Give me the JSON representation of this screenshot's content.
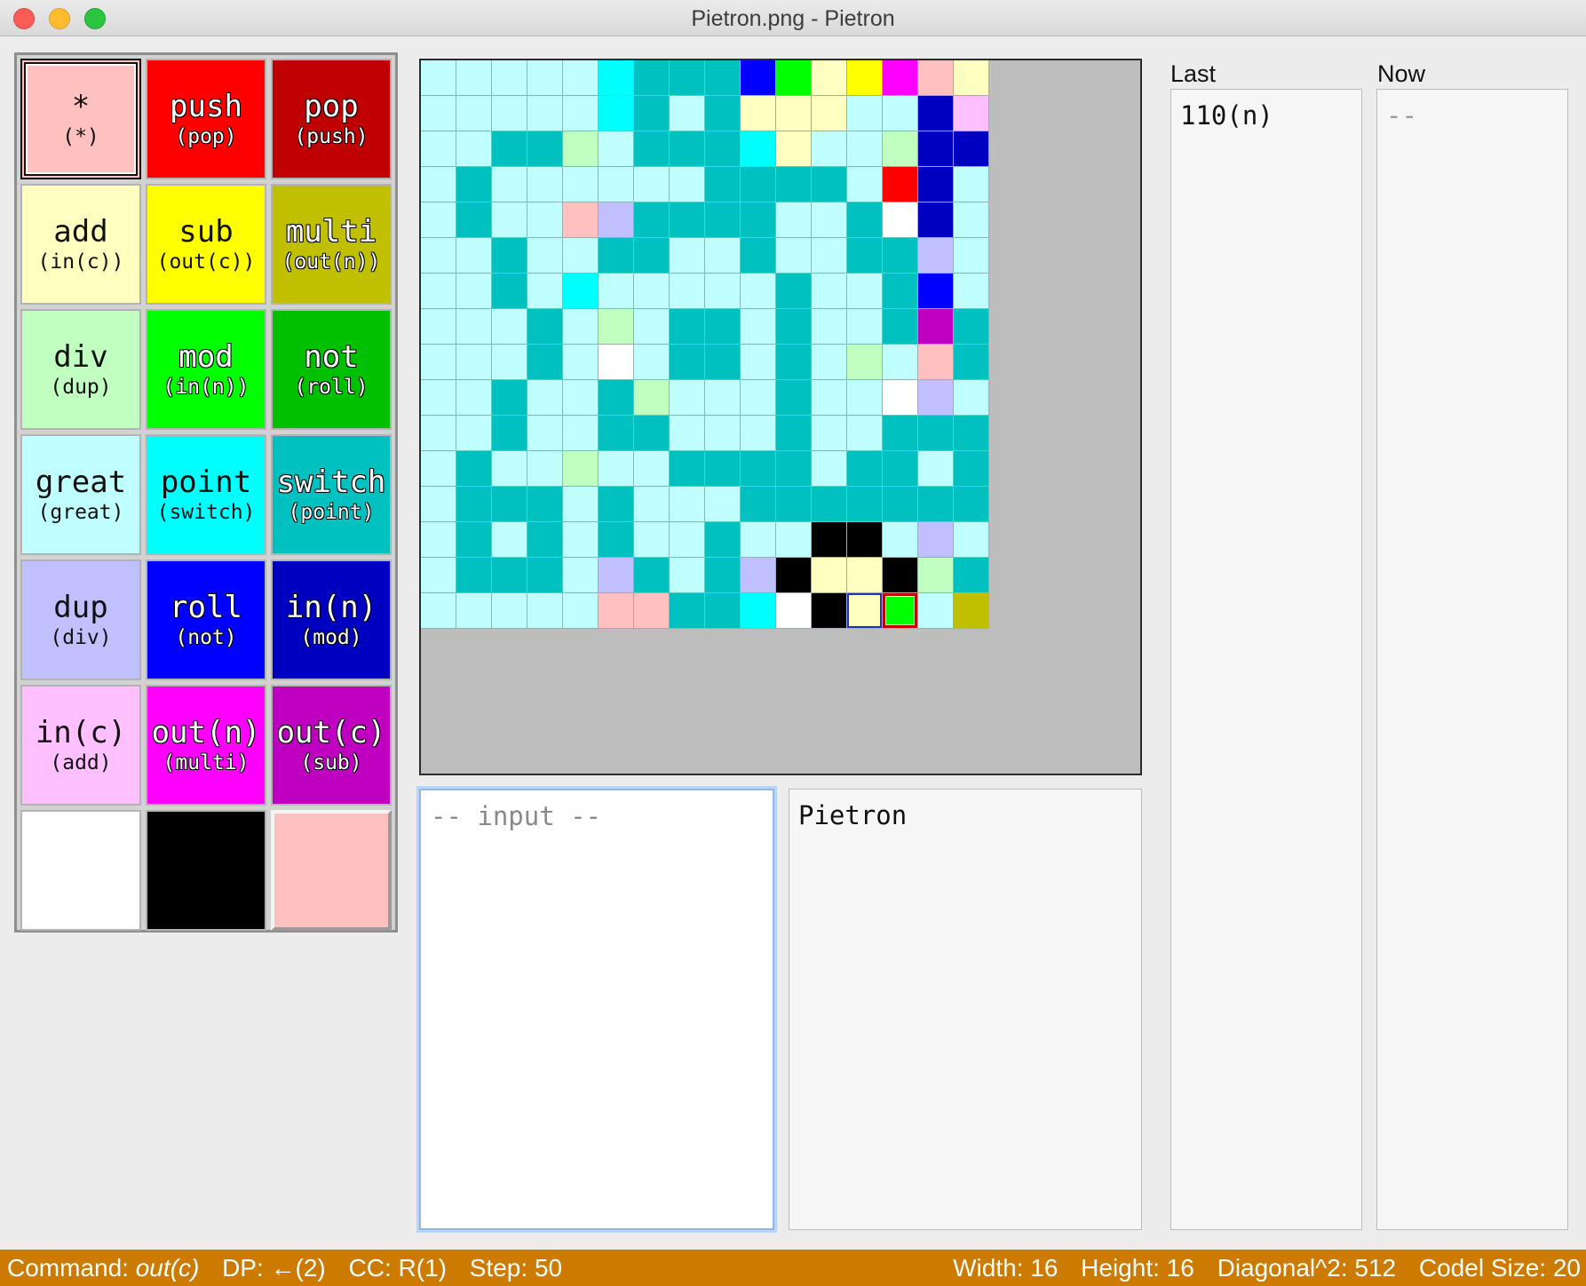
{
  "window": {
    "title": "Pietron.png - Pietron"
  },
  "palette": [
    {
      "op": "*",
      "sub": "(*)",
      "color": "#ffc0c0",
      "text": "light",
      "selected": true
    },
    {
      "op": "push",
      "sub": "(pop)",
      "color": "#ff0000",
      "text": "dark"
    },
    {
      "op": "pop",
      "sub": "(push)",
      "color": "#c00000",
      "text": "dark"
    },
    {
      "op": "add",
      "sub": "(in(c))",
      "color": "#ffffc0",
      "text": "light"
    },
    {
      "op": "sub",
      "sub": "(out(c))",
      "color": "#ffff00",
      "text": "light"
    },
    {
      "op": "multi",
      "sub": "(out(n))",
      "color": "#c0c000",
      "text": "dark"
    },
    {
      "op": "div",
      "sub": "(dup)",
      "color": "#c0ffc0",
      "text": "light"
    },
    {
      "op": "mod",
      "sub": "(in(n))",
      "color": "#00ff00",
      "text": "dark"
    },
    {
      "op": "not",
      "sub": "(roll)",
      "color": "#00c000",
      "text": "dark"
    },
    {
      "op": "great",
      "sub": "(great)",
      "color": "#c0ffff",
      "text": "light"
    },
    {
      "op": "point",
      "sub": "(switch)",
      "color": "#00ffff",
      "text": "light"
    },
    {
      "op": "switch",
      "sub": "(point)",
      "color": "#00c0c0",
      "text": "dark"
    },
    {
      "op": "dup",
      "sub": "(div)",
      "color": "#c0c0ff",
      "text": "light"
    },
    {
      "op": "roll",
      "sub": "(not)",
      "color": "#0000ff",
      "text": "dark"
    },
    {
      "op": "in(n)",
      "sub": "(mod)",
      "color": "#0000c0",
      "text": "dark"
    },
    {
      "op": "in(c)",
      "sub": "(add)",
      "color": "#ffc0ff",
      "text": "light"
    },
    {
      "op": "out(n)",
      "sub": "(multi)",
      "color": "#ff00ff",
      "text": "dark"
    },
    {
      "op": "out(c)",
      "sub": "(sub)",
      "color": "#c000c0",
      "text": "dark"
    },
    {
      "op": "",
      "sub": "",
      "color": "#ffffff",
      "text": "light"
    },
    {
      "op": "",
      "sub": "",
      "color": "#000000",
      "text": "light"
    },
    {
      "op": "",
      "sub": "",
      "color": "#ffc0c0",
      "text": "light",
      "raised": true
    }
  ],
  "canvas": {
    "cols": 16,
    "rows": 16,
    "legend": {
      "a": "#c0ffff",
      "b": "#00c0c0",
      "c": "#00ffff",
      "d": "#0000ff",
      "e": "#00ff00",
      "f": "#ffffc0",
      "g": "#ffff00",
      "h": "#ff00ff",
      "i": "#ffc0c0",
      "j": "#c0ffc0",
      "k": "#c0c0ff",
      "l": "#0000c0",
      "m": "#ff0000",
      "n": "#ffffff",
      "o": "#c000c0",
      "p": "#000000",
      "q": "#ffc0ff",
      "r": "#c0c000"
    },
    "rows_data": [
      "aaaaacbbbdefghif",
      "aaaaacbabfffaalq",
      "aabbjabbbcfaajll",
      "abaaaaaabbbbamla",
      "abaaikbbbbaabnla",
      "aabaabbaabaabbka",
      "aabacaaaaabaabda",
      "aaabajabbabaabob",
      "aaabanabbabajaib",
      "aabaabjaaabaanka",
      "aabaabbaaabaabbb",
      "abaajaabbbbabbab",
      "abbbabaaabbbbbbb",
      "abababaabaappaka",
      "abbbakbabkpffpjb",
      "aaaaaiibbcnpffar"
    ],
    "markers": [
      {
        "row": 15,
        "col": 12,
        "style": "mark-blue",
        "name": "current-codel-marker"
      },
      {
        "row": 15,
        "col": 13,
        "style": "mark-red",
        "name": "next-codel-marker",
        "color": "#00ff00"
      }
    ]
  },
  "input": {
    "placeholder": "-- input --"
  },
  "output": {
    "text": "Pietron"
  },
  "stack": {
    "last_label": "Last",
    "last_value": "110(n)",
    "now_label": "Now",
    "now_value": "--"
  },
  "status": {
    "command_label": "Command:",
    "command_value": "out(c)",
    "dp": "DP: ←(2)",
    "cc": "CC: R(1)",
    "step": "Step: 50",
    "width": "Width: 16",
    "height": "Height: 16",
    "diagonal": "Diagonal^2: 512",
    "codel_size": "Codel Size: 20"
  }
}
